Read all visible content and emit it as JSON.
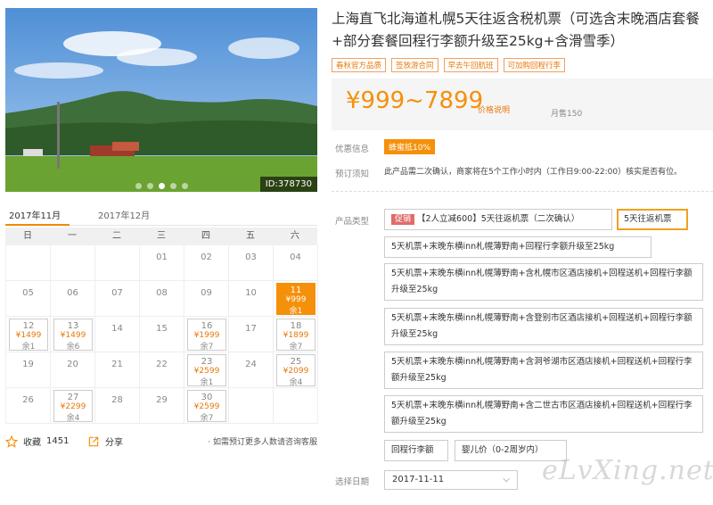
{
  "photo": {
    "id_label": "ID:378730"
  },
  "calendar": {
    "months": [
      "2017年11月",
      "2017年12月"
    ],
    "weekdays": [
      "日",
      "一",
      "二",
      "三",
      "四",
      "五",
      "六"
    ],
    "weeks": [
      [
        {
          "d": ""
        },
        {
          "d": ""
        },
        {
          "d": ""
        },
        {
          "d": "01"
        },
        {
          "d": "02"
        },
        {
          "d": "03"
        },
        {
          "d": "04"
        }
      ],
      [
        {
          "d": "05"
        },
        {
          "d": "06"
        },
        {
          "d": "07"
        },
        {
          "d": "08"
        },
        {
          "d": "09"
        },
        {
          "d": "10"
        },
        {
          "d": "11",
          "p": "¥999",
          "s": "余1",
          "sel": true
        }
      ],
      [
        {
          "d": "12",
          "p": "¥1499",
          "s": "余1"
        },
        {
          "d": "13",
          "p": "¥1499",
          "s": "余6"
        },
        {
          "d": "14"
        },
        {
          "d": "15"
        },
        {
          "d": "16",
          "p": "¥1999",
          "s": "余7"
        },
        {
          "d": "17"
        },
        {
          "d": "18",
          "p": "¥1899",
          "s": "余7"
        }
      ],
      [
        {
          "d": "19"
        },
        {
          "d": "20"
        },
        {
          "d": "21"
        },
        {
          "d": "22"
        },
        {
          "d": "23",
          "p": "¥2599",
          "s": "余1"
        },
        {
          "d": "24"
        },
        {
          "d": "25",
          "p": "¥2099",
          "s": "余4"
        }
      ],
      [
        {
          "d": "26"
        },
        {
          "d": "27",
          "p": "¥2299",
          "s": "余4"
        },
        {
          "d": "28"
        },
        {
          "d": "29"
        },
        {
          "d": "30",
          "p": "¥2599",
          "s": "余7"
        },
        {
          "d": ""
        },
        {
          "d": ""
        }
      ]
    ]
  },
  "share": {
    "fav_label": "收藏",
    "fav_count": "1451",
    "share_label": "分享",
    "note": "· 如需预订更多人数请咨询客服"
  },
  "product": {
    "title": "上海直飞北海道札幌5天往返含税机票（可选含末晚酒店套餐+部分套餐回程行李额升级至25kg+含滑雪季）",
    "tags": [
      "春秋官方品质",
      "签放游合同",
      "早去午回航班",
      "可加购回程行李"
    ],
    "price": "¥999~7899",
    "price_explain": "价格说明",
    "sold": "月售150",
    "coupon_label": "优惠信息",
    "coupon": "蜂蜜抵10%",
    "notice_label": "预订须知",
    "notice": "此产品需二次确认，商家将在5个工作小时内（工作日9:00-22:00）核实是否有位。",
    "type_label": "产品类型",
    "opt1_promo": "促销",
    "opt1": "【2人立减600】5天往返机票（二次确认）",
    "opt2": "5天往返机票",
    "opt3": "5天机票+末晚东横inn札幌薄野南+回程行李额升级至25kg",
    "opt4": "5天机票+末晚东横inn札幌薄野南+含札幌市区酒店接机+回程送机+回程行李额升级至25kg",
    "opt5": "5天机票+末晚东横inn札幌薄野南+含登别市区酒店接机+回程送机+回程行李额升级至25kg",
    "opt6": "5天机票+末晚东横inn札幌薄野南+含洞爷湖市区酒店接机+回程送机+回程行李额升级至25kg",
    "opt7": "5天机票+末晚东横inn札幌薄野南+含二世古市区酒店接机+回程送机+回程行李额升级至25kg",
    "opt8": "回程行李额",
    "opt9": "婴儿价（0-2周岁内）",
    "date_label": "选择日期",
    "date_value": "2017-11-11",
    "watermark": "eLvXing.net"
  },
  "colors": {
    "accent": "#f5900a",
    "promo": "#e06b6b"
  }
}
